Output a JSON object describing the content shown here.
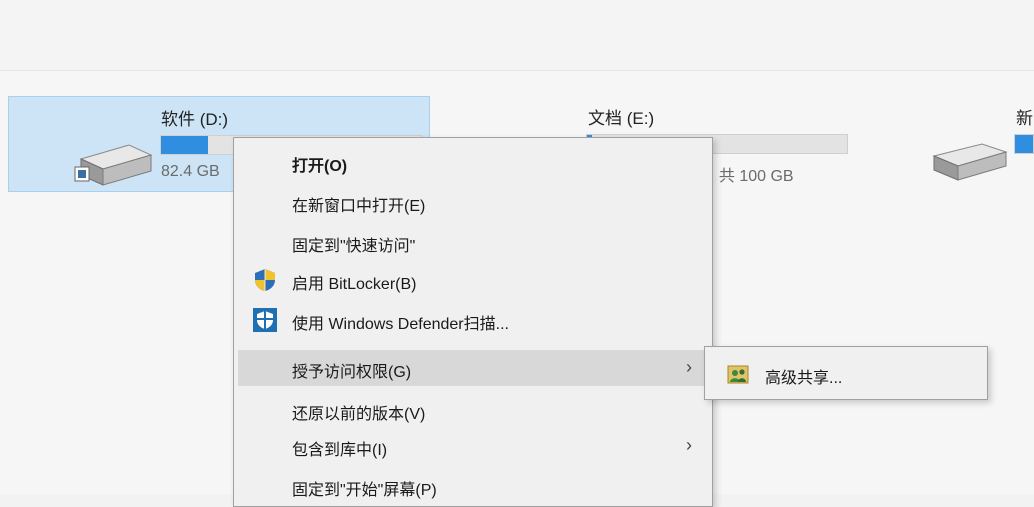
{
  "drives": [
    {
      "name": "软件 (D:)",
      "info": "82.4 GB",
      "used_fraction": 0.18,
      "selected": true
    },
    {
      "name": "文档 (E:)",
      "info": ", 共 100 GB",
      "used_fraction": 0.02,
      "selected": false
    },
    {
      "name": "新",
      "info": "",
      "used_fraction": 1.0,
      "selected": false
    }
  ],
  "context_menu": {
    "items": [
      {
        "label": "打开(O)",
        "icon": "",
        "bold": true
      },
      {
        "label": "在新窗口中打开(E)",
        "icon": ""
      },
      {
        "label": "固定到\"快速访问\"",
        "icon": ""
      },
      {
        "label": "启用 BitLocker(B)",
        "icon": "bitlocker-shield-icon"
      },
      {
        "label": "使用 Windows Defender扫描...",
        "icon": "windows-defender-icon"
      },
      {
        "label": "授予访问权限(G)",
        "icon": "",
        "submenu": true,
        "highlighted": true
      },
      {
        "label": "还原以前的版本(V)",
        "icon": ""
      },
      {
        "label": "包含到库中(I)",
        "icon": "",
        "submenu": true
      },
      {
        "label": "固定到\"开始\"屏幕(P)",
        "icon": ""
      }
    ],
    "submenu_arrow": "›"
  },
  "sub_menu": {
    "items": [
      {
        "label": "高级共享...",
        "icon": "users-share-icon"
      }
    ]
  },
  "colors": {
    "selection_bg": "#cce4f6",
    "drive_bar_fill": "#2f8ee0",
    "menu_bg": "#f0f0f0",
    "menu_hover": "#d8d8d8"
  }
}
